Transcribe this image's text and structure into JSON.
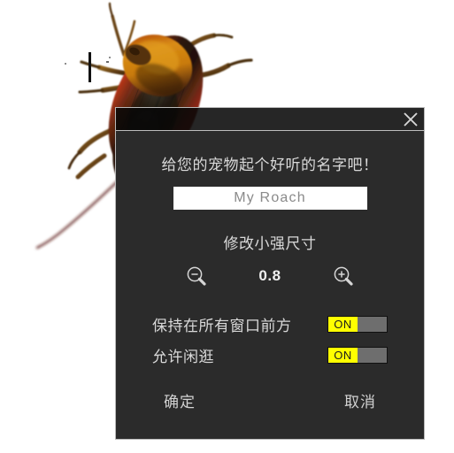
{
  "canvas": {
    "background": "#ffffff",
    "artwork": {
      "name": "cockroach-illustration",
      "description": "photo-realistic cockroach seen from above, angled diagonally",
      "body_color": "#3a1d10",
      "pronotum_color": "#c8820f",
      "wing_edge_color": "#9c1f10",
      "leg_color": "#7a4a17"
    },
    "caret": {
      "name": "text-caret",
      "color": "#111111"
    }
  },
  "dialog": {
    "titlebar": {
      "background": "#080808",
      "close_label": "×",
      "close_icon": "close-icon"
    },
    "prompt": "给您的宠物起个好听的名字吧！",
    "name_field": {
      "value": "My Roach",
      "placeholder": "My Roach",
      "text_color": "#7e7e7e",
      "background": "#ffffff"
    },
    "size_section": {
      "label": "修改小强尺寸",
      "value": "0.8",
      "decrease_icon": "zoom-out-icon",
      "increase_icon": "zoom-in-icon"
    },
    "toggles": [
      {
        "label": "保持在所有窗口前方",
        "state": "ON",
        "on_color": "#ffff00",
        "track_color": "#6e6e6e"
      },
      {
        "label": "允许闲逛",
        "state": "ON",
        "on_color": "#ffff00",
        "track_color": "#6e6e6e"
      }
    ],
    "buttons": {
      "confirm": "确定",
      "cancel": "取消"
    },
    "colors": {
      "body_background": "#2b2b2b",
      "text": "#d9d9d9",
      "border": "#b9b9b9"
    }
  }
}
